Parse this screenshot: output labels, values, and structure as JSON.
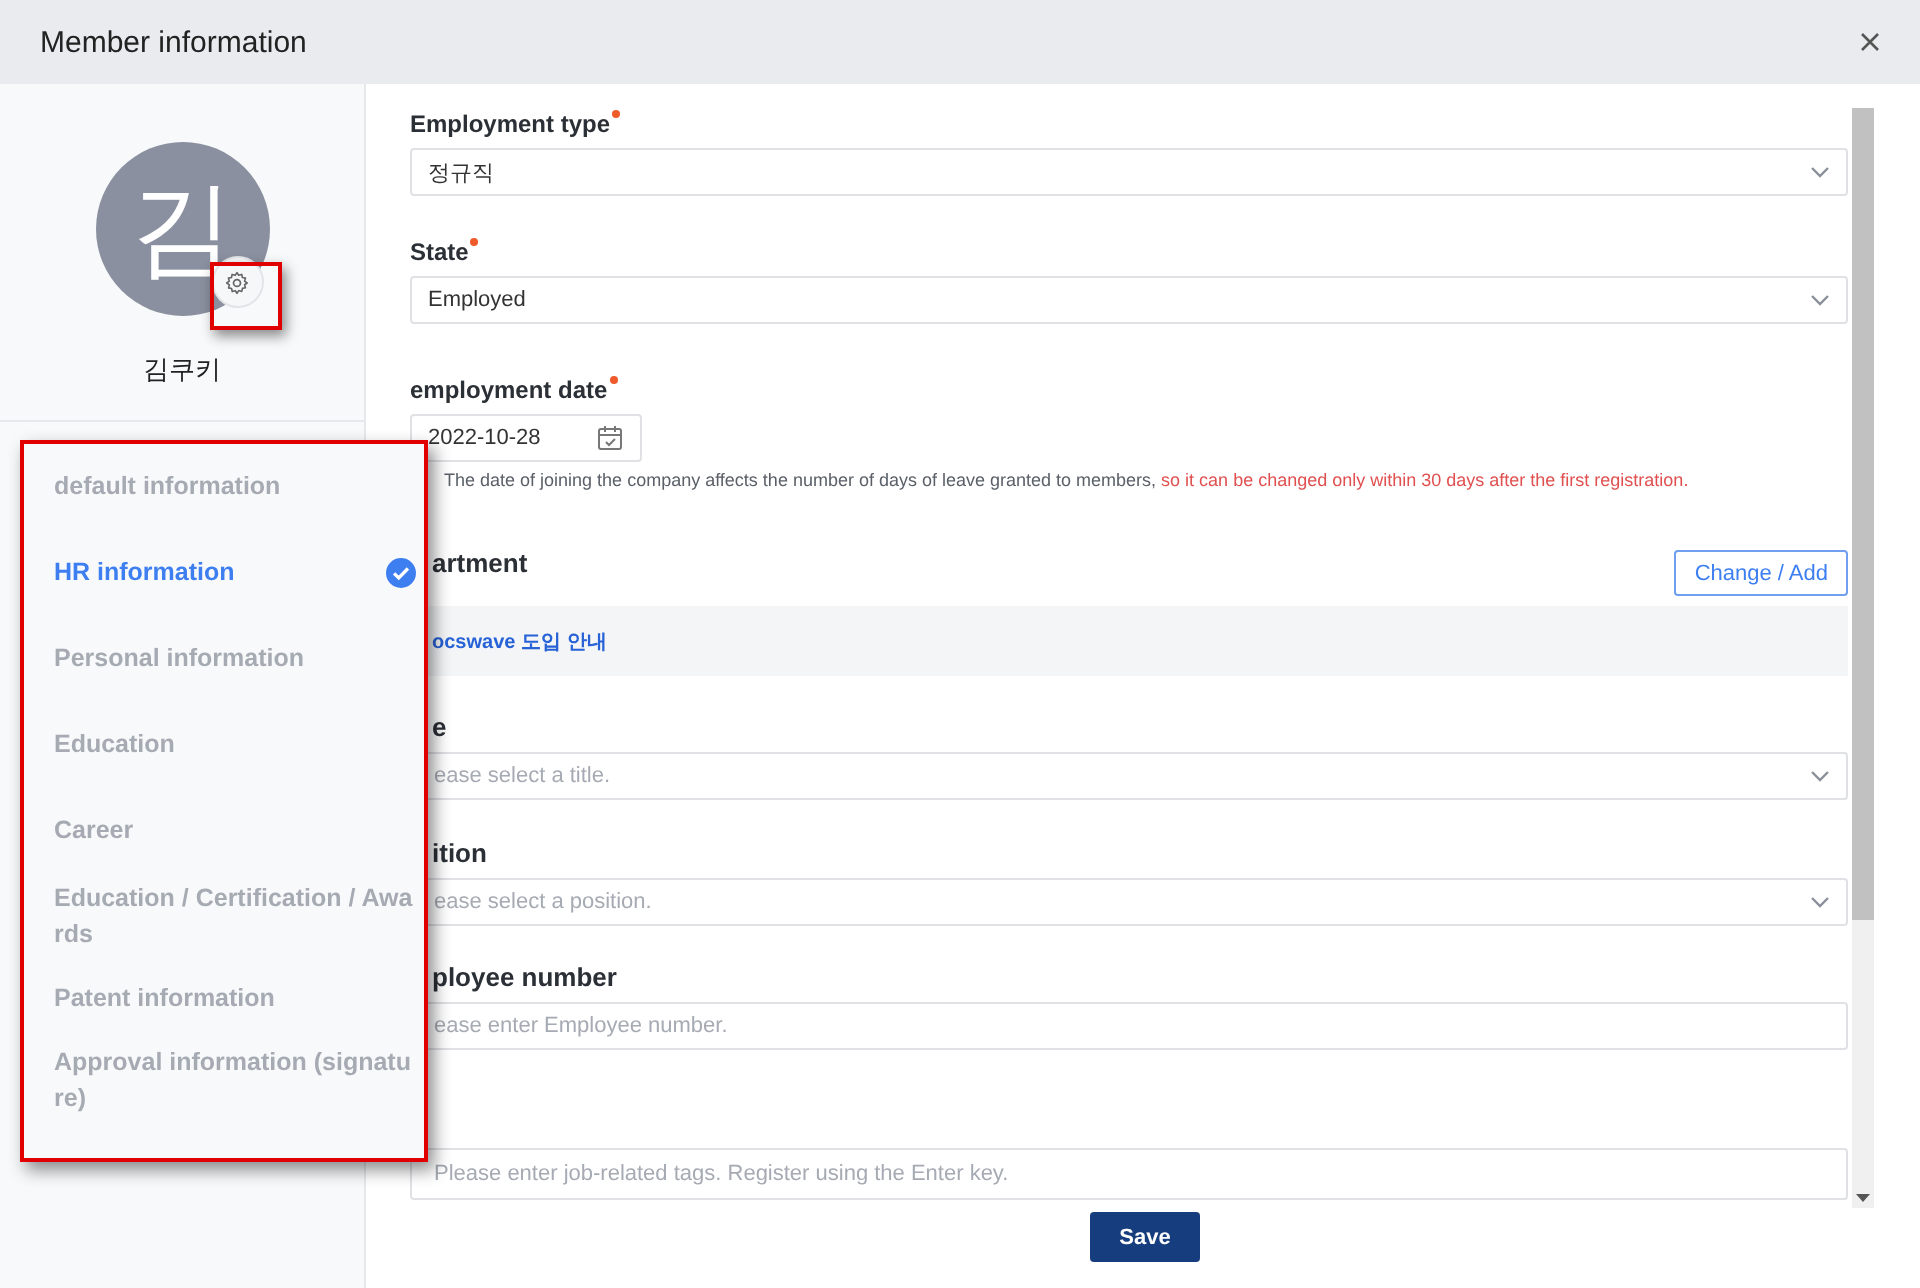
{
  "window": {
    "title": "Member information"
  },
  "profile": {
    "initial": "김",
    "name": "김쿠키"
  },
  "menu": [
    {
      "label": "default information",
      "selected": false
    },
    {
      "label": "HR information",
      "selected": true
    },
    {
      "label": "Personal information",
      "selected": false
    },
    {
      "label": "Education",
      "selected": false
    },
    {
      "label": "Career",
      "selected": false
    },
    {
      "label": "Education / Certification / Awards",
      "selected": false
    },
    {
      "label": "Patent information",
      "selected": false
    },
    {
      "label": "Approval information (signature)",
      "selected": false
    }
  ],
  "fields": [
    {
      "kind": "select",
      "label": "Employment type",
      "required": true,
      "value": "정규직"
    },
    {
      "kind": "select",
      "label": "State",
      "required": true,
      "value": "Employed"
    },
    {
      "kind": "date",
      "label": "employment date",
      "required": true,
      "value": "2022-10-28",
      "note": "The date of joining the company affects the number of days of leave granted to members, ",
      "warning": "so it can be changed only within 30 days after the first registration."
    },
    {
      "kind": "department",
      "label": "artment",
      "required": false,
      "button": "Change / Add",
      "link": "ocswave 도입 안내"
    },
    {
      "kind": "select",
      "label": "e",
      "required": false,
      "placeholder": "ease select a title."
    },
    {
      "kind": "select",
      "label": "ition",
      "required": false,
      "placeholder": "ease select a position."
    },
    {
      "kind": "text",
      "label": "ployee number",
      "required": false,
      "placeholder": "ease enter Employee number."
    },
    {
      "kind": "text",
      "required": false,
      "placeholder": "Please enter job-related tags. Register using the Enter key."
    }
  ],
  "save": "Save"
}
